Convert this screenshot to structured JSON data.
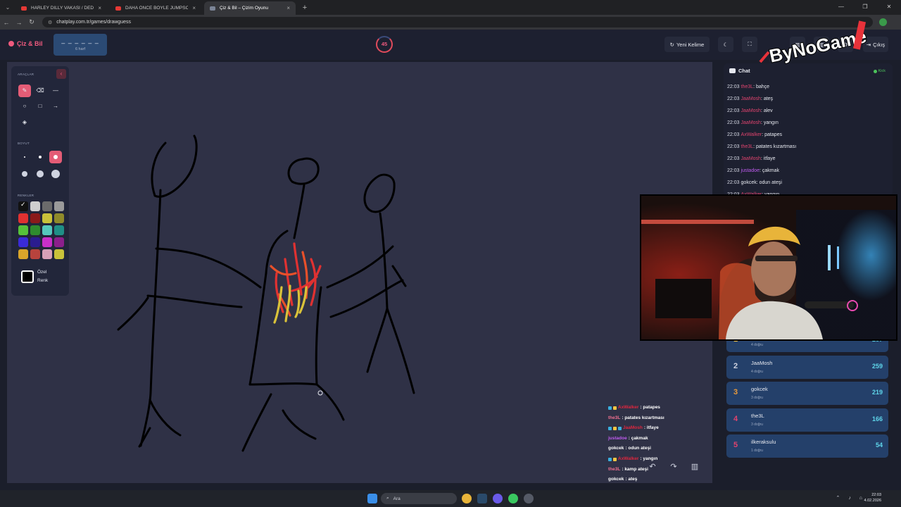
{
  "browser": {
    "tabs": [
      {
        "title": "HARLEY DILLY VAKASI / DEDEK",
        "active": false
      },
      {
        "title": "DAHA ÖNCE BÖYLE JUMPSCAR",
        "active": false
      },
      {
        "title": "Çiz & Bil – Çizim Oyunu",
        "active": true
      }
    ],
    "url": "chatplay.com.tr/games/drawguess"
  },
  "app": {
    "brand": "Çiz & Bil",
    "word_mask": "– – – – – –",
    "word_length": "6 harf",
    "timer": "45",
    "new_word_label": "Yeni Kelime",
    "exit_label": "Çıkış",
    "overlay_logo": "ByNoGame"
  },
  "tools": {
    "section_tools": "ARAÇLAR",
    "section_size": "BOYUT",
    "section_colors": "RENKLER",
    "custom_color_label": "Özel Renk",
    "colors": [
      "#111111",
      "#cfcfcf",
      "#6b6b6b",
      "#9a9a9a",
      "#e03131",
      "#8b1a1a",
      "#c9c23a",
      "#8f8a2a",
      "#56c23a",
      "#2e8b2e",
      "#55c8bd",
      "#1f8f86",
      "#3a2bd6",
      "#2a1c8f",
      "#c830c8",
      "#8b1f8b",
      "#d9a52a",
      "#b8433d",
      "#d8a0b8",
      "#c9c23a"
    ]
  },
  "chat": {
    "title": "Chat",
    "platform": "Kick",
    "messages": [
      {
        "time": "22:03",
        "user": "the3L",
        "text": ": bahçe",
        "color": "#e0436e"
      },
      {
        "time": "22:03",
        "user": "JaaMosh",
        "text": ": ateş",
        "color": "#e0436e"
      },
      {
        "time": "22:03",
        "user": "JaaMosh",
        "text": ": alev",
        "color": "#e0436e"
      },
      {
        "time": "22:03",
        "user": "JaaMosh",
        "text": ": yangın",
        "color": "#e0436e"
      },
      {
        "time": "22:03",
        "user": "AxWalker",
        "text": ": patapes",
        "color": "#e0436e"
      },
      {
        "time": "22:03",
        "user": "the3L",
        "text": ": patates kızartması",
        "color": "#e0436e"
      },
      {
        "time": "22:03",
        "user": "JaaMosh",
        "text": ": itfaye",
        "color": "#e0436e"
      },
      {
        "time": "22:03",
        "user": "justadoe",
        "text": ": çakmak",
        "color": "#c05cf0"
      },
      {
        "time": "22:03",
        "user": "gokcek",
        "text": ": odun ateşi",
        "color": "#e6e8ef"
      },
      {
        "time": "22:03",
        "user": "AxWalker",
        "text": ": yangın",
        "color": "#e0436e"
      }
    ]
  },
  "leaderboard": [
    {
      "rank": "1",
      "name": "",
      "correct": "4 doğru",
      "points": "287",
      "rank_color": "#f5c542"
    },
    {
      "rank": "2",
      "name": "JaaMosh",
      "correct": "4 doğru",
      "points": "259",
      "rank_color": "#cfd3e0"
    },
    {
      "rank": "3",
      "name": "gokcek",
      "correct": "3 doğru",
      "points": "219",
      "rank_color": "#e89a3c"
    },
    {
      "rank": "4",
      "name": "the3L",
      "correct": "3 doğru",
      "points": "166",
      "rank_color": "#e0436e"
    },
    {
      "rank": "5",
      "name": "ilkeraksulu",
      "correct": "1 doğru",
      "points": "54",
      "rank_color": "#e0436e"
    }
  ],
  "overlay_chat": [
    {
      "user": "AxWalker",
      "text": ": patapes",
      "user_color": "#e0263e",
      "badges": 2
    },
    {
      "user": "the3L",
      "text": ": patates kızartması",
      "user_color": "#f07090",
      "badges": 0
    },
    {
      "user": "JaaMosh",
      "text": ": itfaye",
      "user_color": "#e0263e",
      "badges": 3
    },
    {
      "user": "justadoe",
      "text": ": çakmak",
      "user_color": "#c05cf0",
      "badges": 0
    },
    {
      "user": "gokcek",
      "text": ": odun ateşi",
      "user_color": "#ffffff",
      "badges": 0
    },
    {
      "user": "AxWalker",
      "text": ": yangın",
      "user_color": "#e0263e",
      "badges": 2
    },
    {
      "user": "the3L",
      "text": ": kamp ateşi",
      "user_color": "#f07090",
      "badges": 0
    },
    {
      "user": "gokcek",
      "text": ": ateş",
      "user_color": "#ffffff",
      "badges": 0
    }
  ],
  "taskbar": {
    "search_placeholder": "Ara",
    "time": "22:03",
    "date": "4.02.2026"
  }
}
